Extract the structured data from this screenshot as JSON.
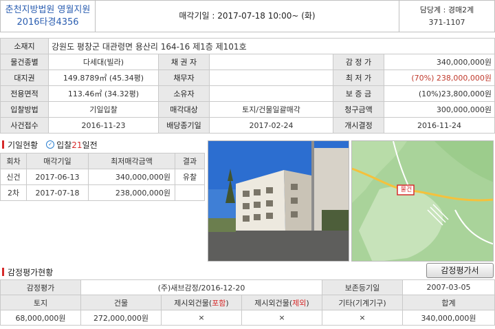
{
  "header": {
    "court": "춘천지방법원 영월지원",
    "case_no": "2016타경4356",
    "sale_date": "매각기일 : 2017-07-18   10:00~ (화)",
    "dept": "담당계 : 경매2계",
    "dept_phone": "371-1107"
  },
  "info": {
    "location_label": "소재지",
    "location": "강원도 평창군 대관령면 용산리 164-16 제1층 제101호",
    "rows": [
      [
        "물건종별",
        "다세대(빌라)",
        "채 권 자",
        "",
        "감 정 가",
        "340,000,000원"
      ],
      [
        "대지권",
        "149.8789㎡ (45.34평)",
        "채무자",
        "",
        "최 저 가",
        "(70%) 238,000,000원"
      ],
      [
        "전용면적",
        "113.46㎡ (34.32평)",
        "소유자",
        "",
        "보 증 금",
        "(10%)23,800,000원"
      ],
      [
        "입찰방법",
        "기일입찰",
        "매각대상",
        "토지/건물일괄매각",
        "청구금액",
        "300,000,000원"
      ],
      [
        "사건접수",
        "2016-11-23",
        "배당종기일",
        "2017-02-24",
        "개시결정",
        "2016-11-24"
      ]
    ]
  },
  "history": {
    "title": "기일현황",
    "badge_pre": "입찰",
    "badge_num": "21",
    "badge_post": "일전",
    "headers": [
      "회차",
      "매각기일",
      "최저매각금액",
      "결과"
    ],
    "rows": [
      [
        "신건",
        "2017-06-13",
        "340,000,000원",
        "유찰"
      ],
      [
        "2차",
        "2017-07-18",
        "238,000,000원",
        ""
      ]
    ]
  },
  "map": {
    "marker": "물건"
  },
  "appraisal": {
    "title": "감정평가현황",
    "button": "감정평가서",
    "row1": [
      "감정평가",
      "(주)새브감정/2016-12-20",
      "보존등기일",
      "2007-03-05"
    ],
    "headers": [
      "토지",
      "건물",
      "제시외건물(포함)",
      "제시외건물(제외)",
      "기타(기계기구)",
      "합계"
    ],
    "values": [
      "68,000,000원",
      "272,000,000원",
      "×",
      "×",
      "×",
      "340,000,000원"
    ]
  }
}
